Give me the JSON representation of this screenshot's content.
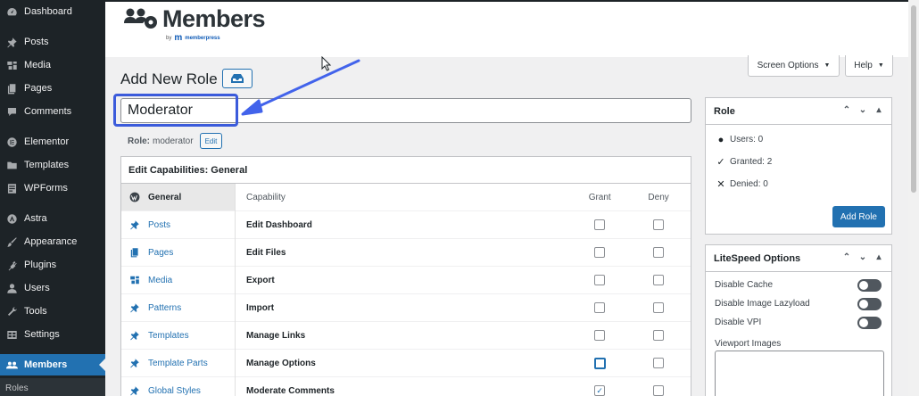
{
  "sidebar": {
    "items": [
      {
        "label": "Dashboard",
        "icon": "dashboard-icon"
      },
      {
        "label": "Posts",
        "icon": "pin-icon"
      },
      {
        "label": "Media",
        "icon": "media-icon"
      },
      {
        "label": "Pages",
        "icon": "pages-icon"
      },
      {
        "label": "Comments",
        "icon": "comment-icon"
      },
      {
        "label": "Elementor",
        "icon": "elementor-icon"
      },
      {
        "label": "Templates",
        "icon": "folder-icon"
      },
      {
        "label": "WPForms",
        "icon": "forms-icon"
      },
      {
        "label": "Astra",
        "icon": "astra-icon"
      },
      {
        "label": "Appearance",
        "icon": "brush-icon"
      },
      {
        "label": "Plugins",
        "icon": "plugin-icon"
      },
      {
        "label": "Users",
        "icon": "user-icon"
      },
      {
        "label": "Tools",
        "icon": "wrench-icon"
      },
      {
        "label": "Settings",
        "icon": "settings-icon"
      },
      {
        "label": "Members",
        "icon": "members-icon",
        "active": true
      }
    ],
    "submenu_first": "Roles"
  },
  "header": {
    "logo_text": "Members",
    "logo_by": "by",
    "logo_mark": "m",
    "logo_brand": "memberpress"
  },
  "top_buttons": {
    "screen_options": "Screen Options",
    "help": "Help"
  },
  "page": {
    "title": "Add New Role",
    "role_name_value": "Moderator",
    "role_slug_label": "Role:",
    "role_slug_value": "moderator",
    "edit_label": "Edit"
  },
  "capabilities": {
    "panel_title": "Edit Capabilities: General",
    "tabs": [
      {
        "label": "General",
        "icon": "wordpress-icon",
        "current": true
      },
      {
        "label": "Posts",
        "icon": "pin-icon"
      },
      {
        "label": "Pages",
        "icon": "pages-icon"
      },
      {
        "label": "Media",
        "icon": "media-icon"
      },
      {
        "label": "Patterns",
        "icon": "pin-icon"
      },
      {
        "label": "Templates",
        "icon": "pin-icon"
      },
      {
        "label": "Template Parts",
        "icon": "pin-icon"
      },
      {
        "label": "Global Styles",
        "icon": "pin-icon"
      }
    ],
    "columns": {
      "capability": "Capability",
      "grant": "Grant",
      "deny": "Deny"
    },
    "rows": [
      {
        "name": "Edit Dashboard",
        "grant": false,
        "deny": false
      },
      {
        "name": "Edit Files",
        "grant": false,
        "deny": false
      },
      {
        "name": "Export",
        "grant": false,
        "deny": false
      },
      {
        "name": "Import",
        "grant": false,
        "deny": false
      },
      {
        "name": "Manage Links",
        "grant": false,
        "deny": false
      },
      {
        "name": "Manage Options",
        "grant": false,
        "deny": false,
        "focus": true
      },
      {
        "name": "Moderate Comments",
        "grant": true,
        "deny": false
      }
    ]
  },
  "role_box": {
    "title": "Role",
    "users": "Users: 0",
    "granted": "Granted: 2",
    "denied": "Denied: 0",
    "add_button": "Add Role"
  },
  "litespeed_box": {
    "title": "LiteSpeed Options",
    "options": [
      "Disable Cache",
      "Disable Image Lazyload",
      "Disable VPI"
    ],
    "viewport_label": "Viewport Images"
  },
  "colors": {
    "sidebar_bg": "#1d2327",
    "accent": "#2271b1",
    "annotation": "#3b5bdb"
  }
}
